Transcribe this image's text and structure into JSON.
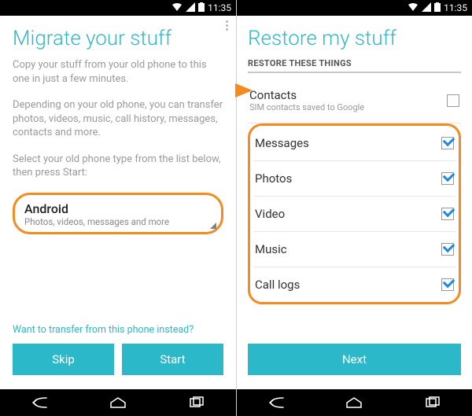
{
  "status": {
    "time": "11:35"
  },
  "left": {
    "title": "Migrate your stuff",
    "para1": "Copy your stuff from your old phone to this one in just a few minutes.",
    "para2": "Depending on your old phone, you can transfer photos, videos, music, call history, messages, contacts and more.",
    "para3": "Select your old phone type from the list below, then press Start:",
    "dropdown": {
      "option": "Android",
      "sub": "Photos, videos, messages and more"
    },
    "link": "Want to transfer from this phone instead?",
    "buttons": {
      "skip": "Skip",
      "start": "Start"
    }
  },
  "right": {
    "title": "Restore my stuff",
    "section_header": "RESTORE THESE THINGS",
    "contacts": {
      "label": "Contacts",
      "sub": "SIM contacts saved to Google",
      "checked": false
    },
    "items": [
      {
        "label": "Messages",
        "checked": true
      },
      {
        "label": "Photos",
        "checked": true
      },
      {
        "label": "Video",
        "checked": true
      },
      {
        "label": "Music",
        "checked": true
      },
      {
        "label": "Call logs",
        "checked": true
      }
    ],
    "next": "Next"
  }
}
